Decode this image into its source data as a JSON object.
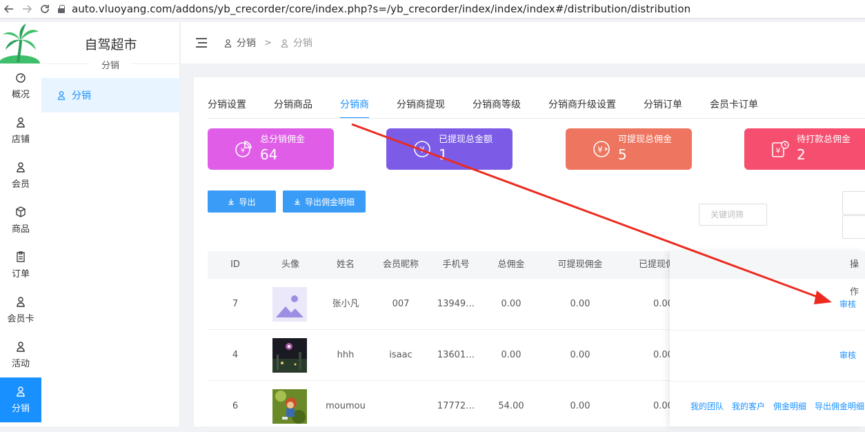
{
  "browser": {
    "url": "auto.vluoyang.com/addons/yb_crecorder/core/index.php?s=/yb_crecorder/index/index/index#/distribution/distribution"
  },
  "sidebar": {
    "items": [
      {
        "label": "概况",
        "icon": "dashboard-icon"
      },
      {
        "label": "店铺",
        "icon": "user-icon"
      },
      {
        "label": "会员",
        "icon": "user-icon"
      },
      {
        "label": "商品",
        "icon": "box-icon"
      },
      {
        "label": "订单",
        "icon": "clipboard-icon"
      },
      {
        "label": "会员卡",
        "icon": "user-icon"
      },
      {
        "label": "活动",
        "icon": "user-icon"
      },
      {
        "label": "分销",
        "icon": "user-icon",
        "active": true
      }
    ]
  },
  "subsidebar": {
    "shop_name": "自驾超市",
    "section": "分销",
    "item": "分销"
  },
  "breadcrumb": {
    "first": "分销",
    "separator": ">",
    "second": "分销"
  },
  "tabs": [
    "分销设置",
    "分销商品",
    "分销商",
    "分销商提现",
    "分销商等级",
    "分销商升级设置",
    "分销订单",
    "会员卡订单"
  ],
  "active_tab": "分销商",
  "cards": [
    {
      "label": "总分销佣金",
      "value": "64",
      "color": "#e05de8"
    },
    {
      "label": "已提现总金额",
      "value": "1",
      "color": "#7c5ce6"
    },
    {
      "label": "可提现总佣金",
      "value": "5",
      "color": "#ee7660"
    },
    {
      "label": "待打款总佣金",
      "value": "2",
      "color": "#f64e6e"
    }
  ],
  "buttons": {
    "export": "导出",
    "export_detail": "导出佣金明细"
  },
  "search": {
    "placeholder": "关键词筛"
  },
  "table": {
    "headers": [
      "ID",
      "头像",
      "姓名",
      "会员昵称",
      "手机号",
      "总佣金",
      "可提现佣金",
      "已提现佣"
    ],
    "op_header": "操作",
    "rows": [
      {
        "id": "7",
        "name": "张小凡",
        "nickname": "007",
        "phone": "13949…",
        "total": "0.00",
        "withdrawable": "0.00",
        "withdrawn": "0.00",
        "avatar": "placeholder-image"
      },
      {
        "id": "4",
        "name": "hhh",
        "nickname": "isaac",
        "phone": "13601…",
        "total": "0.00",
        "withdrawable": "0.00",
        "withdrawn": "0.00",
        "avatar": "night-photo"
      },
      {
        "id": "6",
        "name": "moumou",
        "nickname": "",
        "phone": "17772…",
        "total": "54.00",
        "withdrawable": "0.00",
        "withdrawn": "0.00",
        "avatar": "cartoon-photo"
      }
    ],
    "ops": {
      "review": "审核",
      "team": "我的团队",
      "customers": "我的客户",
      "commission_detail": "佣金明细",
      "export_commission": "导出佣金明细"
    }
  }
}
